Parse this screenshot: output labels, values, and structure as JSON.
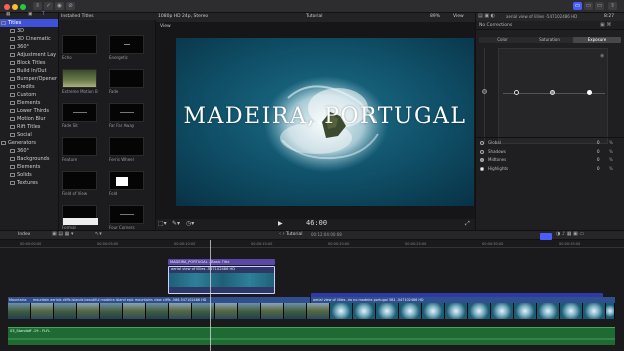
{
  "titlebar": {},
  "sidebar": {
    "items": [
      {
        "label": "Titles",
        "level": 0,
        "selected": true
      },
      {
        "label": "3D",
        "level": 1
      },
      {
        "label": "3D Cinematic",
        "level": 1
      },
      {
        "label": "360°",
        "level": 1
      },
      {
        "label": "Adjustment Lay",
        "level": 1
      },
      {
        "label": "Block Titles",
        "level": 1
      },
      {
        "label": "Build In/Out",
        "level": 1
      },
      {
        "label": "Bumper/Opener",
        "level": 1
      },
      {
        "label": "Credits",
        "level": 1
      },
      {
        "label": "Custom",
        "level": 1
      },
      {
        "label": "Elements",
        "level": 1
      },
      {
        "label": "Lower Thirds",
        "level": 1
      },
      {
        "label": "Motion Blur",
        "level": 1
      },
      {
        "label": "Rift Titles",
        "level": 1
      },
      {
        "label": "Social",
        "level": 1
      },
      {
        "label": "Generators",
        "level": 0
      },
      {
        "label": "360°",
        "level": 1
      },
      {
        "label": "Backgrounds",
        "level": 1
      },
      {
        "label": "Elements",
        "level": 1
      },
      {
        "label": "Solids",
        "level": 1
      },
      {
        "label": "Textures",
        "level": 1
      }
    ]
  },
  "browser": {
    "header": "Installed Titles",
    "thumbs": [
      {
        "label": "Echo",
        "style": "plain"
      },
      {
        "label": "Energetic",
        "style": "dots"
      },
      {
        "label": "Extreme Motion Blur",
        "style": "photo"
      },
      {
        "label": "Fade",
        "style": "plain"
      },
      {
        "label": "Fade Sit",
        "style": "text"
      },
      {
        "label": "Far Far Away",
        "style": "text"
      },
      {
        "label": "Feature",
        "style": "plain"
      },
      {
        "label": "Ferris Wheel",
        "style": "plain"
      },
      {
        "label": "Field of View",
        "style": "plain"
      },
      {
        "label": "Fold",
        "style": "white"
      },
      {
        "label": "Formal",
        "style": "whitebar"
      },
      {
        "label": "Four Corners",
        "style": "text"
      }
    ]
  },
  "viewer": {
    "format": "1080p HD 24p, Stereo",
    "project": "Tutorial",
    "zoom": "89%",
    "view_label": "View",
    "view_menu": "View",
    "title_text": "MADEIRA, PORTUGAL",
    "timecode": "46:00"
  },
  "inspector": {
    "clip_name": "aerial view of lillies -547102486 HD",
    "clip_duration": "8:27",
    "corrections": "No Corrections",
    "tabs": [
      "Color",
      "Saturation",
      "Exposure"
    ],
    "active_tab": "Exposure",
    "rows": [
      {
        "label": "Global",
        "value": "0",
        "unit": "%"
      },
      {
        "label": "Shadows",
        "value": "0",
        "unit": "%"
      },
      {
        "label": "Midtones",
        "value": "0",
        "unit": "%"
      },
      {
        "label": "Highlights",
        "value": "0",
        "unit": "%"
      }
    ]
  },
  "timeline": {
    "index_label": "Index",
    "project": "Tutorial",
    "position": "00:12:04:00:08",
    "ruler": [
      "00:00:00:00",
      "00:00:05:00",
      "00:00:10:00",
      "00:00:15:00",
      "00:00:20:00",
      "00:00:25:00",
      "00:00:30:00",
      "00:00:35:00"
    ],
    "title_clip": "MADEIRA_PORTUGAL - Basic Title",
    "upper_clip": "aerial view of lillies -547102486 HD",
    "main_clip_left": "Mountains",
    "main_clip_mid": "mountain aerials cliffs islands beautiful madeira island epic mountains view cliffs -586-547102486 HD",
    "main_clip_right": "aerial view of lillies -rio no madeira portugal 5B1 -547102486 HD",
    "audio_label": "03_Standoff -19 - FLFL"
  },
  "colors": {
    "accent": "#4b5cff",
    "title_purple": "#4e3e96",
    "upper_clip": "#30386f",
    "audio_green": "#2a7a3a"
  }
}
